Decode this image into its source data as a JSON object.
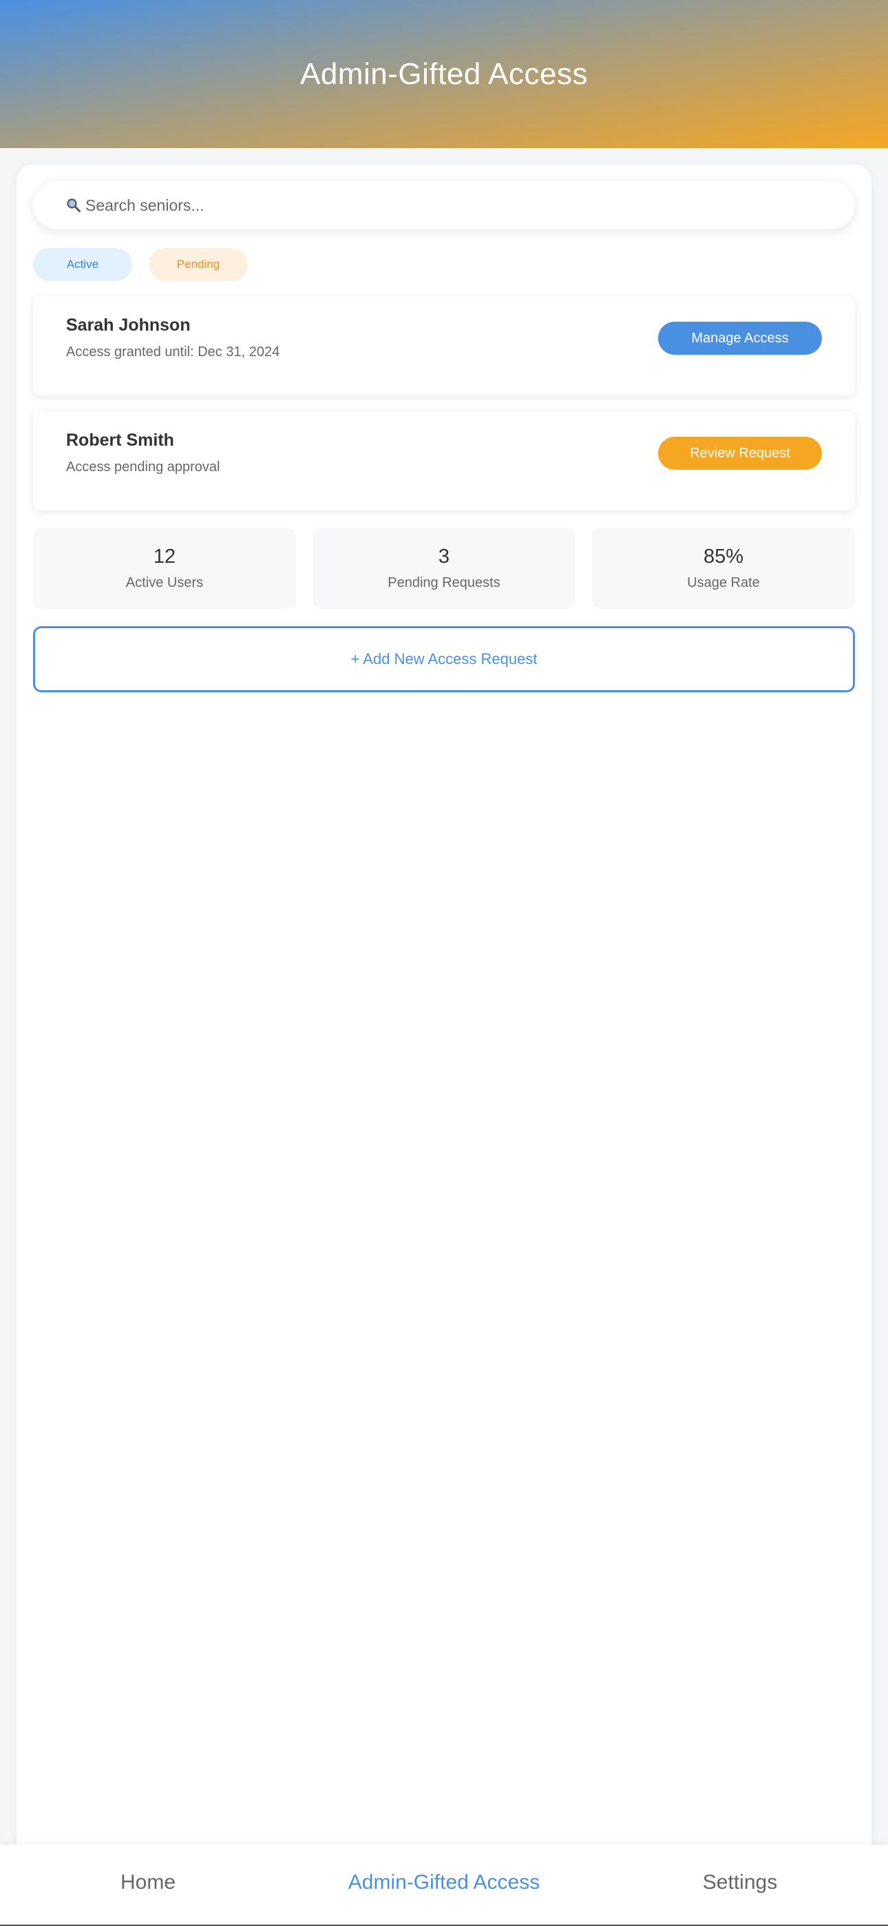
{
  "header": {
    "title": "Admin-Gifted Access"
  },
  "search": {
    "placeholder": "Search seniors..."
  },
  "filters": [
    {
      "label": "Active",
      "color": "#3a82d6"
    },
    {
      "label": "Pending",
      "color": "#ef8f22"
    }
  ],
  "users": [
    {
      "name": "Sarah Johnson",
      "status": "Access granted until: Dec 31, 2024",
      "action": "Manage Access",
      "action_color": "#4a90e2"
    },
    {
      "name": "Robert Smith",
      "status": "Access pending approval",
      "action": "Review Request",
      "action_color": "#f5a623"
    }
  ],
  "stats": [
    {
      "value": "12",
      "label": "Active Users"
    },
    {
      "value": "3",
      "label": "Pending Requests"
    },
    {
      "value": "85%",
      "label": "Usage Rate"
    }
  ],
  "add_request": {
    "label": "+ Add New Access Request"
  },
  "nav": {
    "items": [
      {
        "label": "Home",
        "active": false
      },
      {
        "label": "Admin-Gifted Access",
        "active": true
      },
      {
        "label": "Settings",
        "active": false
      }
    ]
  },
  "colors": {
    "primary": "#4a90e2",
    "accent": "#f5a623"
  },
  "icons": {
    "search": "search-icon"
  }
}
